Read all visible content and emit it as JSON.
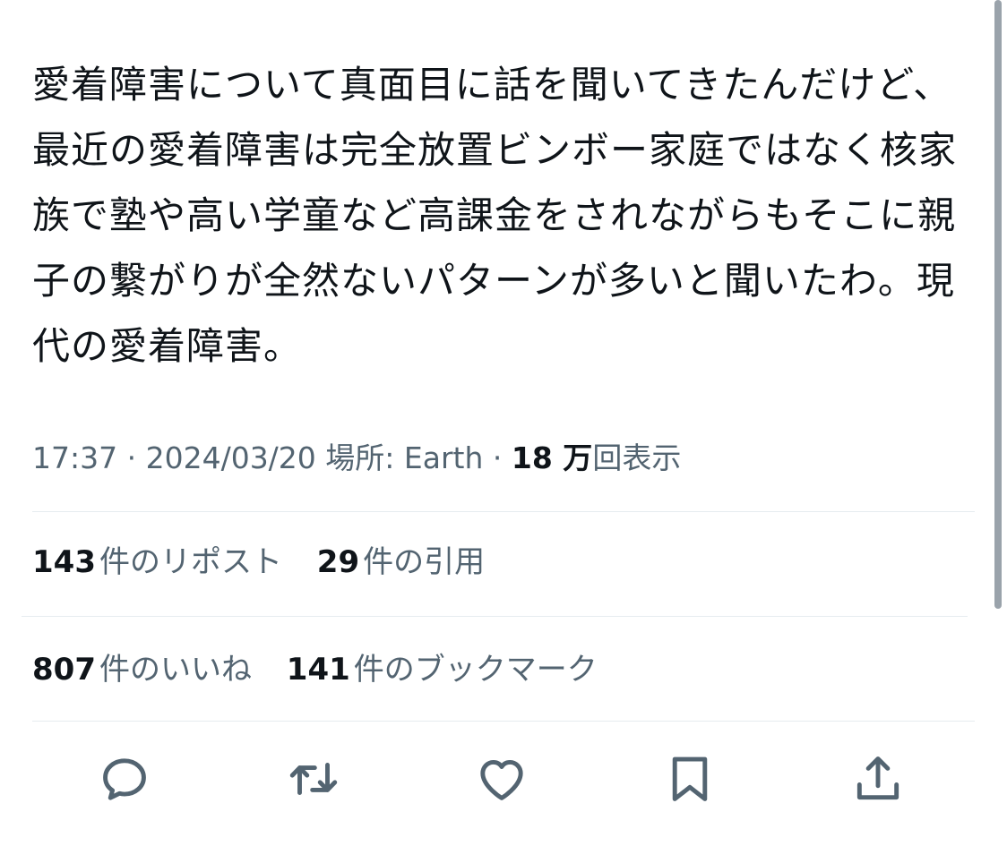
{
  "tweet": {
    "text": "愛着障害について真面目に話を聞いてきたんだけど、最近の愛着障害は完全放置ビンボー家庭ではなく核家族で塾や高い学童など高課金をされながらもそこに親子の繋がりが全然ないパターンが多いと聞いたわ。現代の愛着障害。"
  },
  "meta": {
    "time": "17:37",
    "sep1": " · ",
    "date": "2024/03/20",
    "location_label": "場所: Earth",
    "sep2": " · ",
    "views_count": "18 万",
    "views_label": "回表示"
  },
  "stats": {
    "reposts_count": "143",
    "reposts_label": "件のリポスト",
    "quotes_count": "29",
    "quotes_label": "件の引用",
    "likes_count": "807",
    "likes_label": "件のいいね",
    "bookmarks_count": "141",
    "bookmarks_label": "件のブックマーク"
  },
  "actions": [
    {
      "name": "reply",
      "icon": "reply-icon"
    },
    {
      "name": "repost",
      "icon": "repost-icon"
    },
    {
      "name": "like",
      "icon": "heart-icon"
    },
    {
      "name": "bookmark",
      "icon": "bookmark-icon"
    },
    {
      "name": "share",
      "icon": "share-icon"
    }
  ],
  "colors": {
    "text": "#0f1419",
    "secondary": "#536471",
    "divider": "#e6ecf0"
  }
}
